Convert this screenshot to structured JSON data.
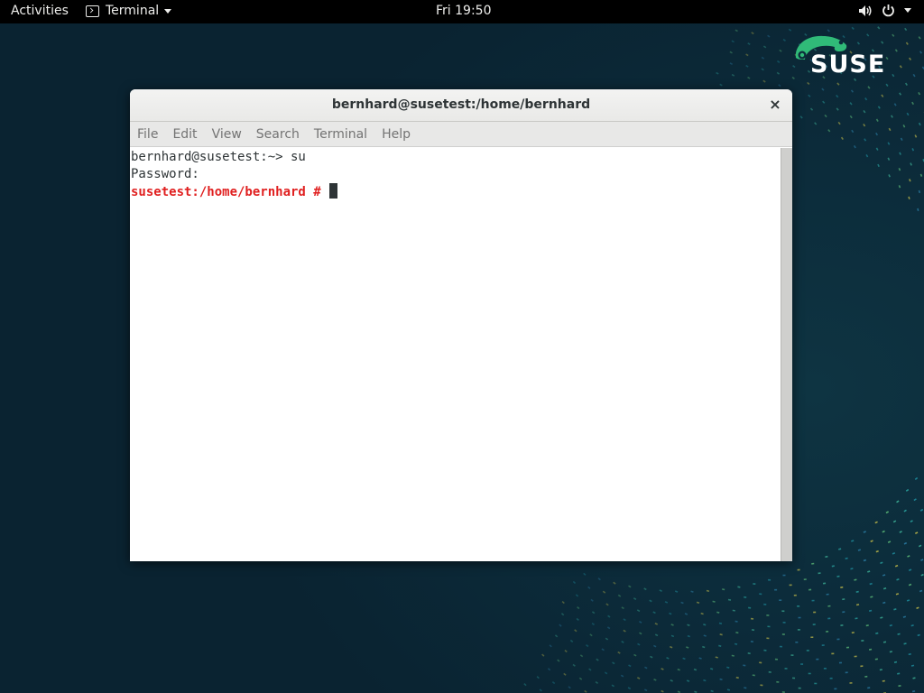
{
  "topbar": {
    "activities": "Activities",
    "app_name": "Terminal",
    "clock": "Fri 19:50"
  },
  "logo": {
    "text": "SUSE"
  },
  "window": {
    "title": "bernhard@susetest:/home/bernhard",
    "close": "×",
    "menu": [
      "File",
      "Edit",
      "View",
      "Search",
      "Terminal",
      "Help"
    ]
  },
  "terminal": {
    "line1": "bernhard@susetest:~> su",
    "line2": "Password:",
    "root_prompt": "susetest:/home/bernhard #"
  },
  "colors": {
    "root_prompt": "#e02020",
    "logo_green": "#30ba78",
    "desktop": "#0c2c3b"
  },
  "icons": [
    "terminal-icon",
    "volume-icon",
    "power-icon",
    "chevron-down-icon",
    "close-icon",
    "suse-chameleon-icon"
  ]
}
